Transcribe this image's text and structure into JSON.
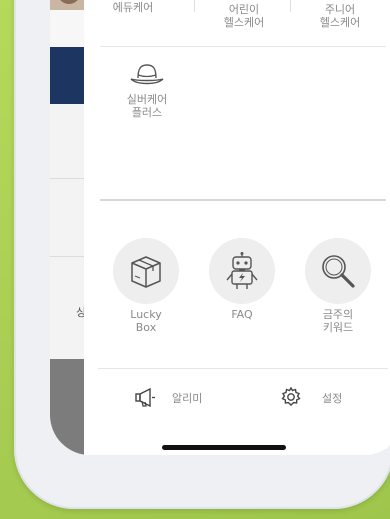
{
  "menu": {
    "row1": [
      {
        "label": "에듀케어",
        "icon": "book-icon"
      },
      {
        "label": "어린이\n헬스케어",
        "icon": "child-face-icon"
      },
      {
        "label": "주니어\n헬스케어",
        "icon": "junior-face-icon"
      }
    ],
    "row2": [
      {
        "label": "실버케어\n플러스",
        "icon": "hat-icon"
      }
    ]
  },
  "features": [
    {
      "label": "Lucky\nBox",
      "icon": "box-icon"
    },
    {
      "label": "FAQ",
      "icon": "robot-icon"
    },
    {
      "label": "금주의\n키워드",
      "icon": "magnifier-icon"
    }
  ],
  "bottom": {
    "notice_label": "알리미",
    "settings_label": "설정"
  },
  "underlay": {
    "partial_char": "싱"
  }
}
